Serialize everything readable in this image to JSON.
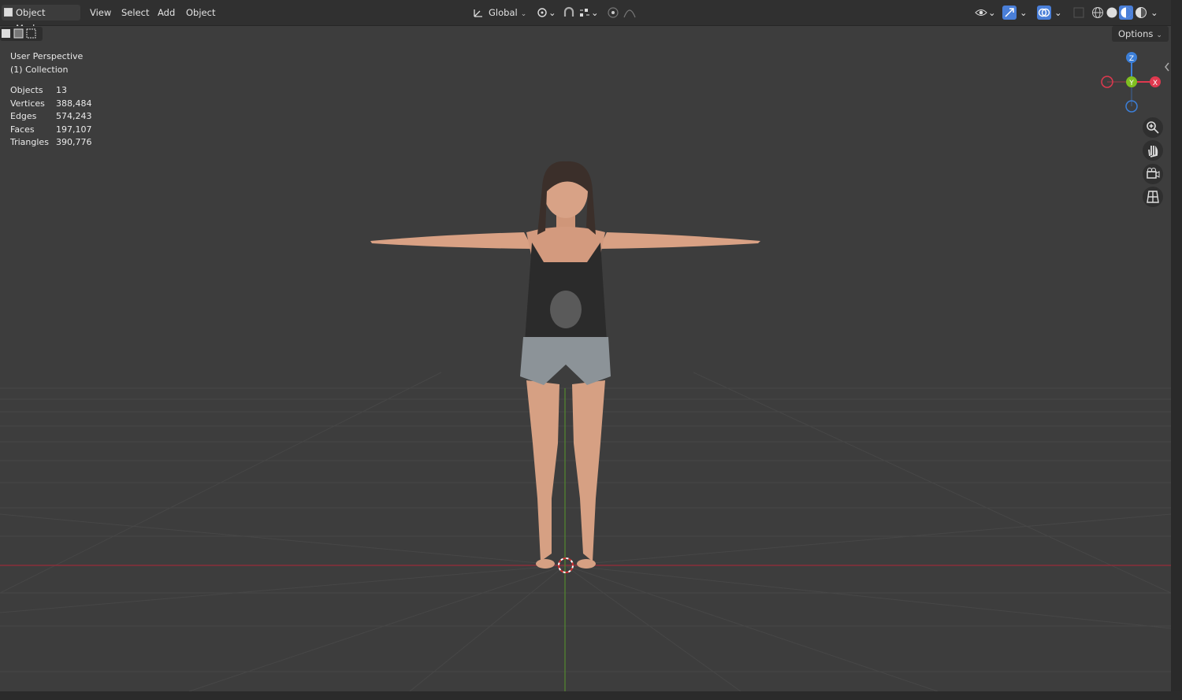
{
  "header": {
    "mode_label": "Object Mode",
    "menus": [
      "View",
      "Select",
      "Add",
      "Object"
    ],
    "transform_orientation": "Global",
    "options_label": "Options"
  },
  "viewport": {
    "view_name": "User Perspective",
    "collection": "(1) Collection",
    "stats": [
      {
        "label": "Objects",
        "value": "13"
      },
      {
        "label": "Vertices",
        "value": "388,484"
      },
      {
        "label": "Edges",
        "value": "574,243"
      },
      {
        "label": "Faces",
        "value": "197,107"
      },
      {
        "label": "Triangles",
        "value": "390,776"
      }
    ]
  },
  "gizmo": {
    "z": "Z",
    "y": "Y",
    "x": "X"
  },
  "colors": {
    "x_axis": "#e0394f",
    "y_axis": "#7fbf20",
    "z_axis": "#3c7fd8",
    "active_shading": "#4a7fd8"
  },
  "icons": [
    "zoom-icon",
    "pan-hand-icon",
    "camera-icon",
    "grid-ortho-icon"
  ]
}
